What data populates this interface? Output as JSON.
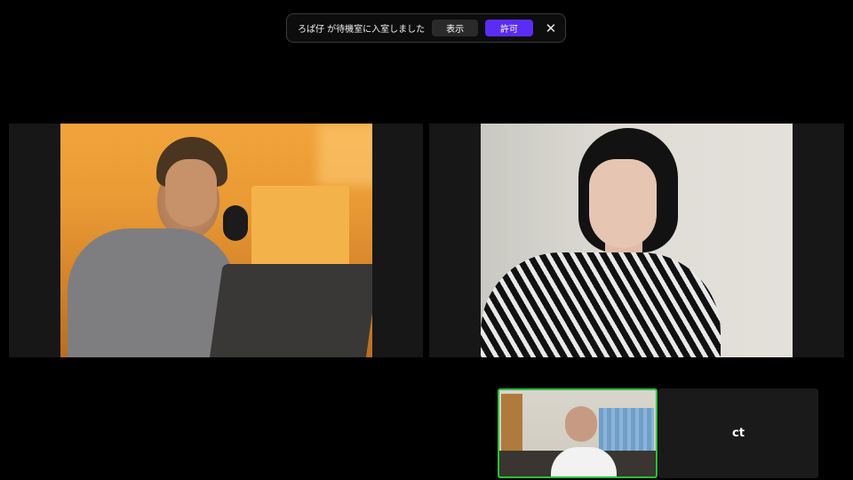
{
  "notification": {
    "message": "ろぱ仔 が待機室に入室しました",
    "view_label": "表示",
    "allow_label": "許可",
    "close_icon": "close-icon"
  },
  "participants": [
    {
      "id": "participant-1",
      "video": "on"
    },
    {
      "id": "participant-2",
      "video": "on"
    },
    {
      "id": "self-view",
      "video": "on",
      "active_speaker": true
    },
    {
      "id": "participant-ct",
      "video": "off",
      "display_name": "ct"
    }
  ],
  "colors": {
    "allow_button": "#5b2cf3",
    "active_speaker_border": "#25c43a",
    "background": "#000000"
  }
}
